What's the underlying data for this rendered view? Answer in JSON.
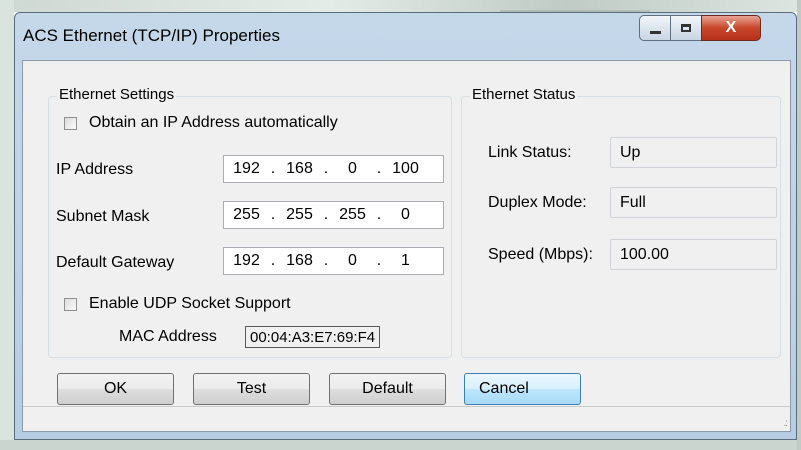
{
  "window": {
    "title": "ACS Ethernet (TCP/IP) Properties",
    "close_glyph": "X"
  },
  "ethernet_settings": {
    "legend": "Ethernet Settings",
    "auto_ip_label": "Obtain an IP Address automatically",
    "auto_ip_checked": false,
    "ip_address": {
      "label": "IP Address",
      "octets": [
        "192",
        "168",
        "0",
        "100"
      ]
    },
    "subnet_mask": {
      "label": "Subnet Mask",
      "octets": [
        "255",
        "255",
        "255",
        "0"
      ]
    },
    "default_gateway": {
      "label": "Default Gateway",
      "octets": [
        "192",
        "168",
        "0",
        "1"
      ]
    },
    "udp_label": "Enable UDP Socket Support",
    "udp_checked": false,
    "mac_label": "MAC Address",
    "mac_value": "00:04:A3:E7:69:F4"
  },
  "ethernet_status": {
    "legend": "Ethernet Status",
    "link_status": {
      "label": "Link Status:",
      "value": "Up"
    },
    "duplex_mode": {
      "label": "Duplex Mode:",
      "value": "Full"
    },
    "speed": {
      "label": "Speed (Mbps):",
      "value": "100.00"
    }
  },
  "buttons": {
    "ok": "OK",
    "test": "Test",
    "default": "Default",
    "cancel": "Cancel"
  },
  "icons": {
    "minimize": "minimize-icon",
    "maximize": "maximize-icon",
    "close": "close-icon",
    "grip": "resize-grip-icon"
  }
}
